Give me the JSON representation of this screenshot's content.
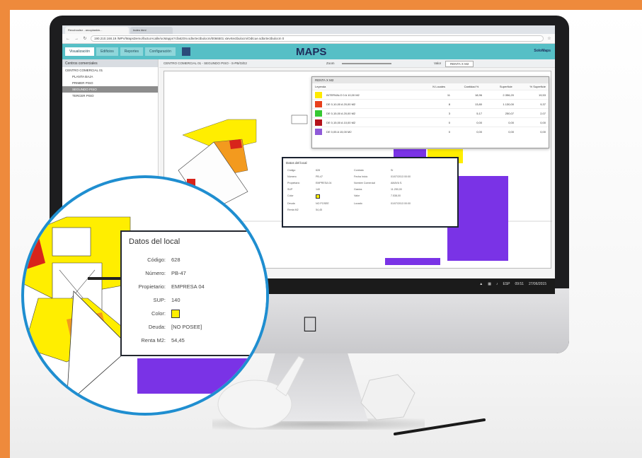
{
  "browser": {
    "tabs": [
      "Recuboolez - arcoplankin...",
      "Indes html"
    ],
    "address": "190.210.168.19",
    "address_full": "190.210.168.19 /MPV/MapsDemo/facturAcalle/ocMapps?cfa62tXv.sdtvrtectbulocm/0066501 xtevrtectbulocm/Odtcue.sdtxrtectbulocm 0"
  },
  "app": {
    "tabs": [
      "Visualización",
      "Edificios",
      "Reportes",
      "Configuración"
    ],
    "title": "MAPS",
    "brand": "SoloMaps"
  },
  "sidebar": {
    "header": "Centros comerciales",
    "items": [
      {
        "label": "CENTRO COMERCIAL 01",
        "level": "root",
        "selected": false
      },
      {
        "label": "PLANTA BAJA",
        "level": "child",
        "selected": false
      },
      {
        "label": "PRIMER PISO",
        "level": "child",
        "selected": false
      },
      {
        "label": "SEGUNDO PISO",
        "level": "child",
        "selected": true
      },
      {
        "label": "TERCER PISO",
        "level": "child",
        "selected": false
      }
    ]
  },
  "map": {
    "toolbar_label": "CENTRO COMERCIAL 01 - SEGUNDO PISO - S-PB/G/E2",
    "zoom_label": "Zoom",
    "value_label": "Valor",
    "value_select": "RENTA X M2"
  },
  "legend": {
    "title": "RENTA X M2",
    "columns": [
      "Leyenda",
      "N Locales",
      "Cantidad %",
      "Superficie",
      "% Superficie"
    ],
    "rows": [
      {
        "label": "INTERVALO 0 A 10,00 M2",
        "color": "#ffea00",
        "n": "11",
        "pct": "18,96",
        "sup": "2.356,20",
        "pct_sup": "19,53"
      },
      {
        "label": "DE 0,10,00 A 20,00 M2",
        "color": "#e8401c",
        "n": "8",
        "pct": "13,80",
        "sup": "1.130,00",
        "pct_sup": "9,37"
      },
      {
        "label": "DE 0,15,00 A 20,00 M2",
        "color": "#36c832",
        "n": "3",
        "pct": "5,17",
        "sup": "250,07",
        "pct_sup": "2,07"
      },
      {
        "label": "DE 0,15,00 A 10,00 M2",
        "color": "#b4121b",
        "n": "0",
        "pct": "0,00",
        "sup": "0,00",
        "pct_sup": "0,00"
      },
      {
        "label": "DE 0,05 A 15,00 M2",
        "color": "#8f5ad8",
        "n": "0",
        "pct": "0,00",
        "sup": "0,00",
        "pct_sup": "0,00"
      }
    ]
  },
  "small_popup": {
    "title": "Datos del local",
    "fields": [
      {
        "label": "Código",
        "value": "628"
      },
      {
        "label": "Número",
        "value": "PB-47"
      },
      {
        "label": "Propietario",
        "value": "EMPRESA 04"
      },
      {
        "label": "SUP",
        "value": "140"
      },
      {
        "label": "Color",
        "value": ""
      },
      {
        "label": "Deuda",
        "value": "NO POSEE"
      },
      {
        "label": "Renta M2",
        "value": "54,45"
      }
    ],
    "fields_right": [
      {
        "label": "Contrato",
        "value": "Sí"
      },
      {
        "label": "Fecha Inicio",
        "value": "01/07/2013 00:00"
      },
      {
        "label": "Nombre Comercial",
        "value": "AMAYA S."
      },
      {
        "label": "Gastos",
        "value": "11.250,00"
      },
      {
        "label": "Valor",
        "value": "7.538,00"
      },
      {
        "label": "Locado",
        "value": "01/07/2013 00:00"
      }
    ]
  },
  "taskbar": {
    "lang": "ESP",
    "time": "09:51",
    "date": "27/06/2015"
  },
  "zoom_popup": {
    "title": "Datos del local",
    "fields": [
      {
        "label": "Código:",
        "value": "628"
      },
      {
        "label": "Número:",
        "value": "PB-47"
      },
      {
        "label": "Propietario:",
        "value": "EMPRESA 04"
      },
      {
        "label": "SUP:",
        "value": "140"
      },
      {
        "label": "Color:",
        "value": ""
      },
      {
        "label": "Deuda:",
        "value": "[NO POSEE]"
      },
      {
        "label": "Renta M2:",
        "value": "54,45"
      }
    ],
    "color_value": "#ffef00"
  },
  "colors": {
    "frame": "#ee8a3c",
    "zoom_ring": "#1f8ed0",
    "app_bar": "#56bfc6",
    "violet": "#7a33e6",
    "yellow": "#ffee00",
    "orange": "#f6a01a",
    "red": "#d8241b"
  }
}
